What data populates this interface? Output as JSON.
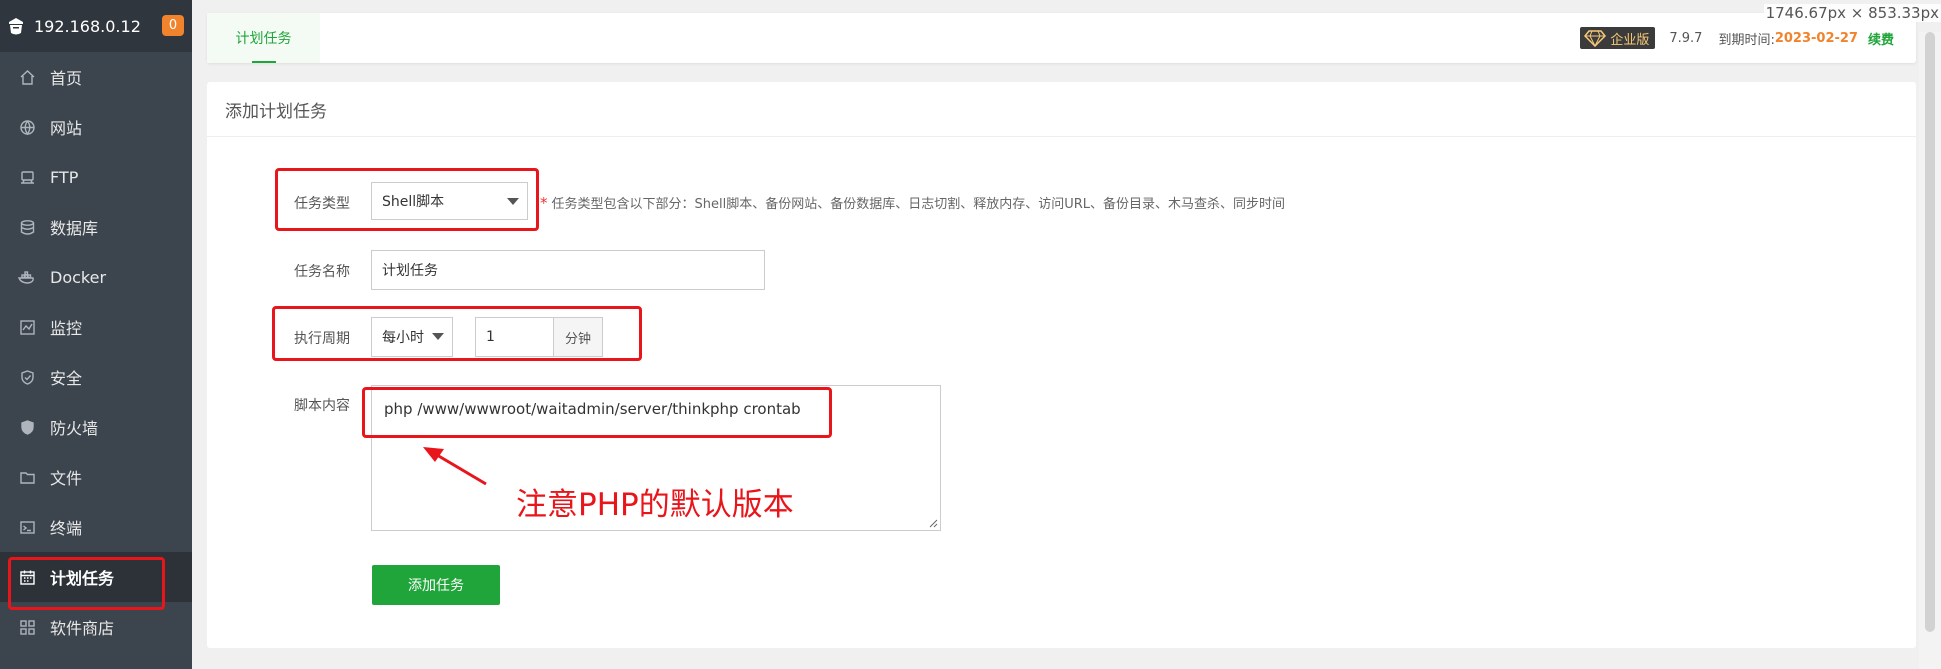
{
  "sidebar": {
    "host": "192.168.0.12",
    "badge": "0",
    "items": [
      {
        "label": "首页",
        "icon": "home-icon"
      },
      {
        "label": "网站",
        "icon": "globe-icon"
      },
      {
        "label": "FTP",
        "icon": "ftp-icon"
      },
      {
        "label": "数据库",
        "icon": "database-icon"
      },
      {
        "label": "Docker",
        "icon": "docker-icon"
      },
      {
        "label": "监控",
        "icon": "monitor-icon"
      },
      {
        "label": "安全",
        "icon": "shield-icon"
      },
      {
        "label": "防火墙",
        "icon": "firewall-icon"
      },
      {
        "label": "文件",
        "icon": "folder-icon"
      },
      {
        "label": "终端",
        "icon": "terminal-icon"
      },
      {
        "label": "计划任务",
        "icon": "calendar-icon",
        "active": true
      },
      {
        "label": "软件商店",
        "icon": "apps-icon"
      }
    ]
  },
  "topbar": {
    "tab": "计划任务",
    "edition": "企业版",
    "version": "7.9.7",
    "expire_label": "到期时间:",
    "expire_date": "2023-02-27",
    "renew": "续费"
  },
  "screen_size": "1746.67px × 853.33px",
  "form": {
    "title": "添加计划任务",
    "task_type_label": "任务类型",
    "task_type_value": "Shell脚本",
    "task_type_hint": "任务类型包含以下部分：Shell脚本、备份网站、备份数据库、日志切割、释放内存、访问URL、备份目录、木马查杀、同步时间",
    "task_name_label": "任务名称",
    "task_name_value": "计划任务",
    "period_label": "执行周期",
    "period_value": "每小时",
    "minute_value": "1",
    "minute_unit": "分钟",
    "script_label": "脚本内容",
    "script_value": "php /www/wwwroot/waitadmin/server/thinkphp crontab",
    "submit": "添加任务"
  },
  "annotation": "注意PHP的默认版本",
  "colors": {
    "accent": "#20a53a",
    "highlight": "#e8151b",
    "sidebar": "#3c444d",
    "expire": "#f0832b"
  }
}
